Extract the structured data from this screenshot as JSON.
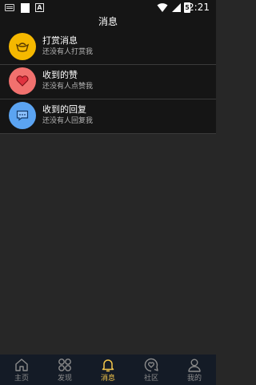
{
  "status_bar": {
    "time": "2:21",
    "keyboard_icon": "keyboard-icon",
    "notification_badge_text": "A",
    "battery_text": "5"
  },
  "header": {
    "title": "消息"
  },
  "messages": [
    {
      "title": "打赏消息",
      "subtitle": "还没有人打赏我",
      "icon": "coin-ingot-icon",
      "color": "#f5b800"
    },
    {
      "title": "收到的赞",
      "subtitle": "还没有人点赞我",
      "icon": "heart-icon",
      "color": "#f1716e"
    },
    {
      "title": "收到的回复",
      "subtitle": "还没有人回复我",
      "icon": "comment-icon",
      "color": "#5ba4f2"
    }
  ],
  "tabs": [
    {
      "label": "主页",
      "icon": "home-icon",
      "active": false
    },
    {
      "label": "发现",
      "icon": "discover-grid-icon",
      "active": false
    },
    {
      "label": "消息",
      "icon": "bell-icon",
      "active": true
    },
    {
      "label": "社区",
      "icon": "community-heart-icon",
      "active": false
    },
    {
      "label": "我的",
      "icon": "profile-icon",
      "active": false
    }
  ],
  "colors": {
    "accent": "#f3c64b",
    "background": "#272727",
    "header": "#151515",
    "tab_bar": "#141b26"
  }
}
